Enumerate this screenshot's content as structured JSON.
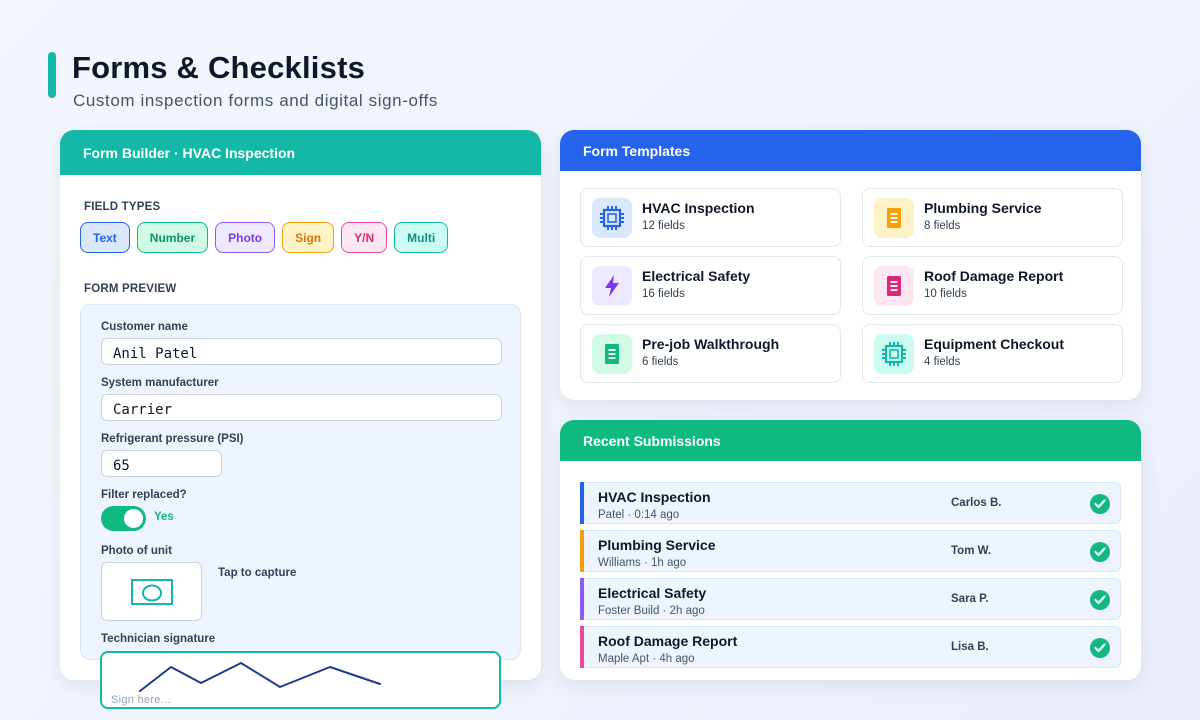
{
  "header": {
    "title": "Forms & Checklists",
    "subtitle": "Custom inspection forms and digital sign-offs"
  },
  "builder": {
    "title": "Form Builder · HVAC Inspection",
    "field_types_label": "FIELD TYPES",
    "field_types": [
      {
        "label": "Text",
        "bg": "#dbe7fb",
        "border": "#2563eb",
        "color": "#2563eb"
      },
      {
        "label": "Number",
        "bg": "#d1fae5",
        "border": "#10b981",
        "color": "#059669"
      },
      {
        "label": "Photo",
        "bg": "#ede9fe",
        "border": "#8b5cf6",
        "color": "#7c3aed"
      },
      {
        "label": "Sign",
        "bg": "#fef3c7",
        "border": "#f59e0b",
        "color": "#d97706"
      },
      {
        "label": "Y/N",
        "bg": "#fce7f3",
        "border": "#ec4899",
        "color": "#db2777"
      },
      {
        "label": "Multi",
        "bg": "#ccfbf1",
        "border": "#14b8a6",
        "color": "#0d9488"
      }
    ],
    "preview_label": "FORM PREVIEW",
    "fields": {
      "customer_name_label": "Customer name",
      "customer_name_value": "Anil Patel",
      "manufacturer_label": "System manufacturer",
      "manufacturer_value": "Carrier",
      "pressure_label": "Refrigerant pressure (PSI)",
      "pressure_value": "65",
      "filter_label": "Filter replaced?",
      "filter_value": "Yes",
      "photo_label": "Photo of unit",
      "photo_hint": "Tap to capture",
      "signature_label": "Technician signature",
      "signature_placeholder": "Sign here..."
    }
  },
  "templates": {
    "title": "Form Templates",
    "items": [
      {
        "name": "HVAC Inspection",
        "count": "12 fields",
        "icon": "chip-icon",
        "icon_bg": "#dbe7fb",
        "icon_color": "#2563eb"
      },
      {
        "name": "Plumbing Service",
        "count": "8 fields",
        "icon": "document-icon",
        "icon_bg": "#fef3c7",
        "icon_color": "#f59e0b"
      },
      {
        "name": "Electrical Safety",
        "count": "16 fields",
        "icon": "lightning-icon",
        "icon_bg": "#ede9fe",
        "icon_color": "#7c3aed"
      },
      {
        "name": "Roof Damage Report",
        "count": "10 fields",
        "icon": "document-icon",
        "icon_bg": "#fce7f3",
        "icon_color": "#db2777"
      },
      {
        "name": "Pre-job Walkthrough",
        "count": "6 fields",
        "icon": "document-icon",
        "icon_bg": "#d1fae5",
        "icon_color": "#10b981"
      },
      {
        "name": "Equipment Checkout",
        "count": "4 fields",
        "icon": "chip-icon",
        "icon_bg": "#ccfbf1",
        "icon_color": "#14b8a6"
      }
    ]
  },
  "submissions": {
    "title": "Recent Submissions",
    "rows": [
      {
        "title": "HVAC Inspection",
        "meta": "Patel · 0:14 ago",
        "user": "Carlos B.",
        "color": "#2563eb"
      },
      {
        "title": "Plumbing Service",
        "meta": "Williams · 1h ago",
        "user": "Tom W.",
        "color": "#f59e0b"
      },
      {
        "title": "Electrical Safety",
        "meta": "Foster Build · 2h ago",
        "user": "Sara P.",
        "color": "#8b5cf6"
      },
      {
        "title": "Roof Damage Report",
        "meta": "Maple Apt · 4h ago",
        "user": "Lisa B.",
        "color": "#ec4899"
      }
    ]
  },
  "colors": {
    "teal": "#14b8a6",
    "blue": "#2563eb",
    "green": "#10b981",
    "ink": "#0f172a"
  }
}
